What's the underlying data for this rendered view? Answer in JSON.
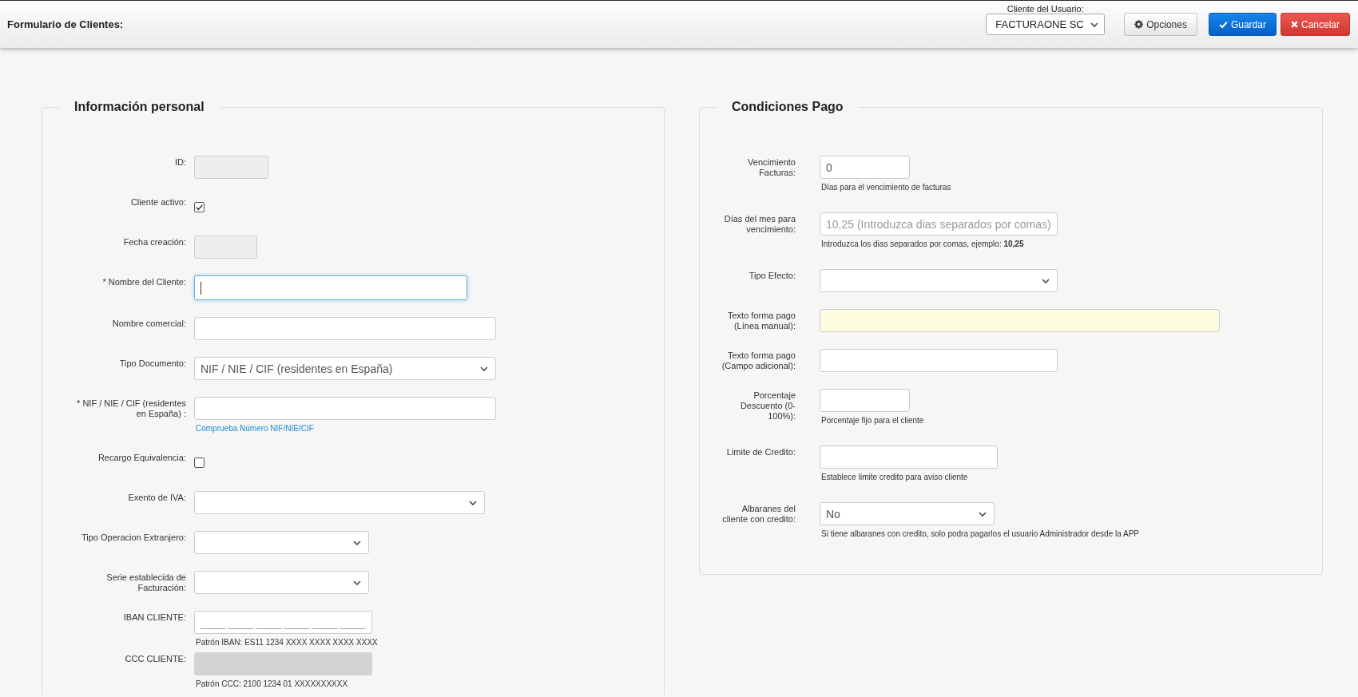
{
  "header": {
    "title": "Formulario de Clientes:",
    "user_client": {
      "label": "Cliente del Usuario:",
      "value": "FACTURAONE SC"
    },
    "buttons": [
      {
        "label": "Opciones",
        "kind": "default"
      },
      {
        "label": "Guardar",
        "kind": "primary"
      },
      {
        "label": "Cancelar",
        "kind": "danger"
      }
    ]
  },
  "sections": [
    {
      "title": "Información personal",
      "rows": [
        {
          "label": "ID:",
          "kind": "text",
          "disabled": true,
          "focused": false,
          "highlighted": false
        },
        {
          "label": "Cliente activo:",
          "kind": "checkbox",
          "checked": true
        },
        {
          "label": "Fecha creación:",
          "kind": "text",
          "disabled": true,
          "focused": false,
          "highlighted": false
        },
        {
          "label": "* Nombre del Cliente:",
          "kind": "text",
          "disabled": false,
          "focused": true,
          "highlighted": false
        },
        {
          "label": "Nombre comercial:",
          "kind": "text",
          "disabled": false,
          "focused": false,
          "highlighted": false
        },
        {
          "label": "Tipo Documento:",
          "kind": "select",
          "value": "NIF / NIE / CIF (residentes en España)",
          "disabled": false,
          "focused": false
        },
        {
          "label": "* NIF / NIE / CIF (residentes en España) :",
          "kind": "text",
          "disabled": false,
          "focused": false,
          "highlighted": false,
          "link": "Comprueba Número NIF/NIE/CIF"
        },
        {
          "label": "Recargo Equivalencia:",
          "kind": "checkbox",
          "checked": false
        },
        {
          "label": "Exento de IVA:",
          "kind": "select",
          "disabled": false,
          "focused": false
        },
        {
          "label": "Tipo Operacion Extranjero:",
          "kind": "select",
          "disabled": false,
          "focused": false
        },
        {
          "label": "Serie establecida de Facturación:",
          "kind": "select",
          "disabled": false,
          "focused": false
        },
        {
          "label": "IBAN CLIENTE:",
          "kind": "text",
          "placeholder": "____ ____ ____ ____ ____ ____",
          "disabled": false,
          "focused": false,
          "highlighted": false,
          "hint": "Patrón IBAN: ES11 1234 XXXX XXXX XXXX XXXX"
        },
        {
          "label": "CCC CLIENTE:",
          "kind": "locked",
          "hint": "Patrón CCC: 2100 1234 01 XXXXXXXXXX"
        }
      ]
    },
    {
      "title": "Condiciones Pago",
      "rows": [
        {
          "label": "Vencimiento Facturas:",
          "kind": "text",
          "value": "0",
          "disabled": false,
          "focused": false,
          "highlighted": false,
          "hint": "Días para el vencimiento de facturas"
        },
        {
          "label": "Días del mes para vencimiento:",
          "kind": "text",
          "placeholder": "10,25 (Introduzca dias separados por comas)",
          "disabled": false,
          "focused": false,
          "highlighted": false,
          "hint": "Introduzca los dias separados por comas, ejemplo: **10,25**"
        },
        {
          "label": "Tipo Efecto:",
          "kind": "select",
          "disabled": false,
          "focused": false
        },
        {
          "label": "Texto forma pago (Línea manual):",
          "kind": "text",
          "disabled": false,
          "focused": false,
          "highlighted": true
        },
        {
          "label": "Texto forma pago (Campo adicional):",
          "kind": "text",
          "disabled": false,
          "focused": false,
          "highlighted": false
        },
        {
          "label": "Porcentaje Descuento (0-100%):",
          "kind": "text",
          "disabled": false,
          "focused": false,
          "highlighted": false,
          "hint": "Porcentaje fijo para el cliente"
        },
        {
          "label": "Limite de Credito:",
          "kind": "text",
          "disabled": false,
          "focused": false,
          "highlighted": false,
          "hint": "Establece limite credito para aviso cliente"
        },
        {
          "label": "Albaranes del cliente con credito:",
          "kind": "select",
          "value": "No",
          "disabled": false,
          "focused": false,
          "hint": "Si tiene albaranes con credito, solo podra pagarlos el usuario Administrador desde la APP"
        }
      ]
    }
  ]
}
